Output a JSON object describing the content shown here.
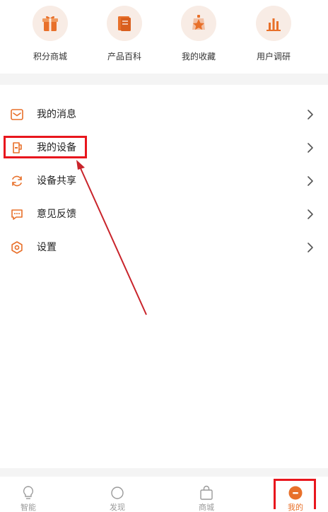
{
  "quick_actions": [
    {
      "label": "积分商城",
      "icon": "gift-icon"
    },
    {
      "label": "产品百科",
      "icon": "book-icon"
    },
    {
      "label": "我的收藏",
      "icon": "star-icon"
    },
    {
      "label": "用户调研",
      "icon": "bar-chart-icon"
    }
  ],
  "menu": {
    "items": [
      {
        "label": "我的消息",
        "icon": "message-icon"
      },
      {
        "label": "我的设备",
        "icon": "device-icon"
      },
      {
        "label": "设备共享",
        "icon": "sync-icon"
      },
      {
        "label": "意见反馈",
        "icon": "feedback-icon"
      },
      {
        "label": "设置",
        "icon": "settings-icon"
      }
    ]
  },
  "tabbar": {
    "tabs": [
      {
        "label": "智能",
        "icon": "lightbulb-icon"
      },
      {
        "label": "发现",
        "icon": "circle-icon"
      },
      {
        "label": "商城",
        "icon": "shopping-bag-icon"
      },
      {
        "label": "我的",
        "icon": "profile-icon"
      }
    ],
    "active_index": 3
  },
  "colors": {
    "accent": "#e8702a",
    "icon_bg": "#f8ece5",
    "annotation_red": "#e8161d",
    "annotation_arrow": "#c9242b"
  }
}
